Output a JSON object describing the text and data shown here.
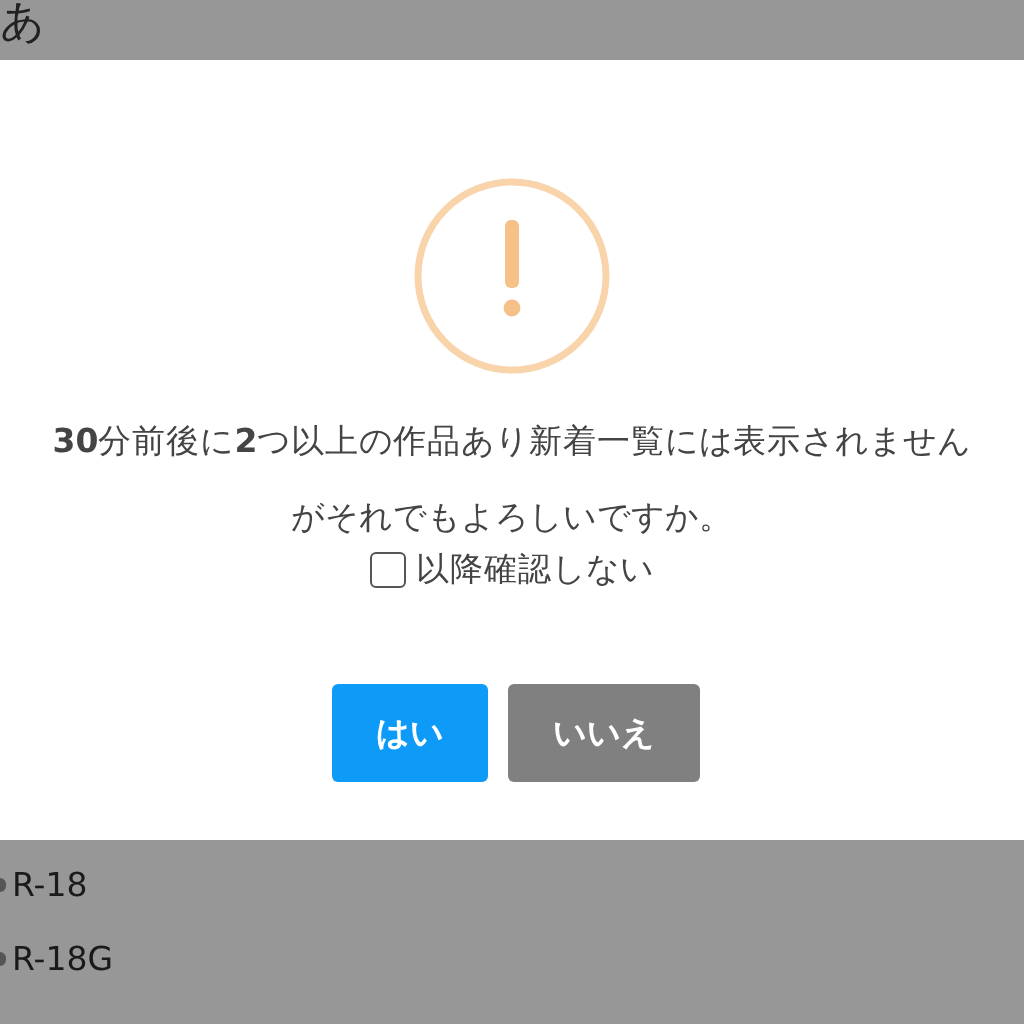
{
  "background_header": {
    "text": "あ"
  },
  "dialog": {
    "message_lines": [
      "**30**分前後に**2**つ以上の作品あり新着一覧には表示されません",
      "がそれでもよろしいですか。"
    ],
    "checkbox": {
      "label": "以降確認しない",
      "checked": false
    },
    "buttons": [
      {
        "label": "はい",
        "kind": "primary"
      },
      {
        "label": "いいえ",
        "kind": "secondary"
      }
    ]
  },
  "background_options": [
    {
      "label": "R-18"
    },
    {
      "label": "R-18G"
    }
  ]
}
